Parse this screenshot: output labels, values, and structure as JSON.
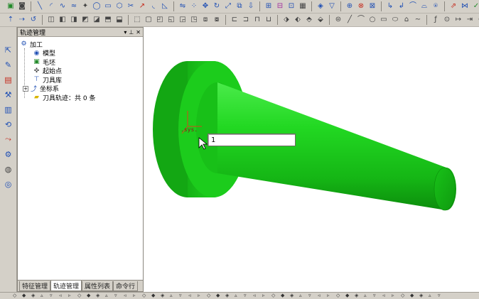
{
  "panel": {
    "title": "轨迹管理",
    "tree": {
      "root": "加工",
      "items": [
        "模型",
        "毛坯",
        "起始点",
        "刀具库",
        "坐标系",
        "刀具轨迹：共 0 条"
      ]
    },
    "tabs": [
      "特征管理",
      "轨迹管理",
      "属性列表",
      "命令行"
    ],
    "active_tab": 1
  },
  "viewport": {
    "axis_label": ".sys.",
    "input_value": "1"
  },
  "colors": {
    "part_green": "#1fd41f",
    "part_dark": "#0e8f10",
    "part_light": "#6ef36b"
  },
  "icons": {
    "toolbar_row1": [
      "open-icon",
      "save-icon",
      "line-icon",
      "arc-icon",
      "curve-icon",
      "spline-icon",
      "point-icon",
      "circle-icon",
      "rect-icon",
      "polygon-icon",
      "trim-icon",
      "extend-icon",
      "fillet-icon",
      "chamfer-icon",
      "mirror-icon",
      "array-icon",
      "move-icon",
      "rotate-icon",
      "scale-icon",
      "offset-icon",
      "project-icon",
      "measure-icon",
      "dimension-icon",
      "text-icon",
      "hatch-icon",
      "layer-icon",
      "color-icon",
      "render-icon",
      "zoom-icon",
      "pan-icon",
      "view-icon",
      "fit-icon"
    ],
    "toolbar_row2": [
      "select-icon",
      "extrude-icon",
      "revolve-icon",
      "loft-icon",
      "sweep-icon",
      "shell-icon",
      "hole-icon",
      "rib-icon",
      "draft-icon",
      "boolean-icon",
      "sketch-icon",
      "plane-icon",
      "axis-icon",
      "point3d-icon",
      "surface-icon",
      "solid-icon",
      "trim-surface-icon",
      "blend-icon",
      "patch-icon",
      "knit-icon",
      "check-icon",
      "undo-icon",
      "redo-icon",
      "line2d-icon",
      "arc2d-icon",
      "circle2d-icon",
      "ellipse2d-icon",
      "rect2d-icon",
      "polygon2d-icon",
      "fx-icon",
      "dim-icon",
      "cancel-icon"
    ]
  }
}
